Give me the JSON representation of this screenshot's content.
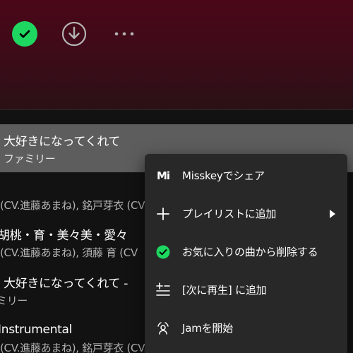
{
  "colors": {
    "accent": "#1ed760",
    "menu_bg": "#282828",
    "highlight_row": "#5d5d5d",
    "hero_top": "#4a0717"
  },
  "actions": [
    {
      "name": "saved-check-icon",
      "state": "saved"
    },
    {
      "name": "download-icon"
    },
    {
      "name": "more-options-icon"
    }
  ],
  "tracks": [
    {
      "title": "大好きになってくれて",
      "artist": "ファミリー",
      "highlighted": true
    },
    {
      "title": "",
      "artist": "(CV.進藤あまね), 銘戸芽衣 (CV"
    },
    {
      "title": "胡桃・育・美々美・愛々",
      "artist": "(CV.進藤あまね), 須藤 育 (CV"
    },
    {
      "title": "大好きになってくれて -",
      "artist": "ミリー"
    },
    {
      "title": "Instrumental",
      "artist": "(CV.進藤あまね), 銘戸芽衣 (CV."
    }
  ],
  "context_menu": {
    "items": [
      {
        "icon": "misskey-icon",
        "label": "Misskeyでシェア"
      },
      {
        "icon": "plus-icon",
        "label": "プレイリストに追加",
        "submenu": true
      },
      {
        "icon": "check-circle-icon",
        "label": "お気に入りの曲から削除する"
      },
      {
        "icon": "add-to-queue-icon",
        "label": "[次に再生] に追加"
      },
      {
        "icon": "jam-icon",
        "label": "Jamを開始"
      }
    ],
    "misskey_glyph": "Mi"
  }
}
